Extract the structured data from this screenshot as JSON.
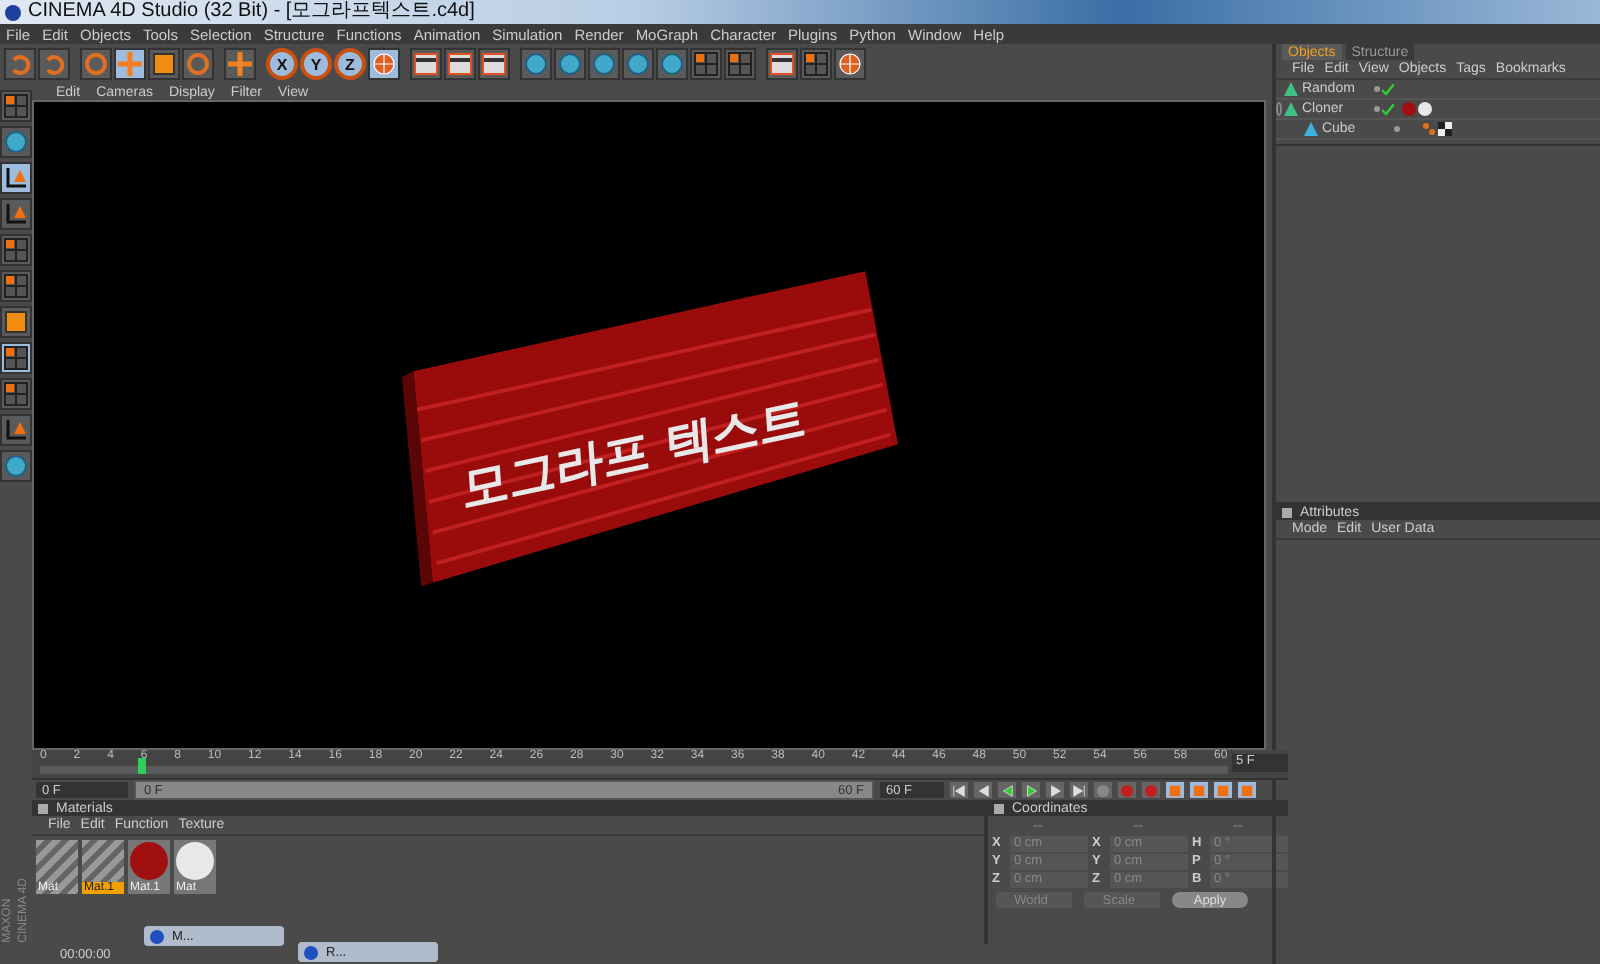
{
  "window": {
    "title": "CINEMA 4D Studio (32 Bit) - [모그라프텍스트.c4d]"
  },
  "menu": [
    "File",
    "Edit",
    "Objects",
    "Tools",
    "Selection",
    "Structure",
    "Functions",
    "Animation",
    "Simulation",
    "Render",
    "MoGraph",
    "Character",
    "Plugins",
    "Python",
    "Window",
    "Help"
  ],
  "toolbar": [
    {
      "kind": "arrow",
      "selected": false
    },
    {
      "kind": "arrow",
      "selected": false
    },
    {
      "kind": "ring",
      "selected": false
    },
    {
      "kind": "cross",
      "selected": true
    },
    {
      "kind": "square",
      "selected": false
    },
    {
      "kind": "ring",
      "selected": false
    },
    {
      "kind": "cross",
      "selected": false
    },
    {
      "kind": "letter",
      "label": "X",
      "selected": true
    },
    {
      "kind": "letter",
      "label": "Y",
      "selected": true
    },
    {
      "kind": "letter",
      "label": "Z",
      "selected": true
    },
    {
      "kind": "globe",
      "selected": true
    },
    {
      "kind": "film",
      "selected": false
    },
    {
      "kind": "film",
      "selected": false
    },
    {
      "kind": "film",
      "selected": false
    },
    {
      "kind": "sphere",
      "selected": false
    },
    {
      "kind": "sphere",
      "selected": false
    },
    {
      "kind": "sphere",
      "selected": false
    },
    {
      "kind": "sphere",
      "selected": false
    },
    {
      "kind": "sphere",
      "selected": false
    },
    {
      "kind": "grid",
      "selected": false
    },
    {
      "kind": "grid",
      "selected": false
    },
    {
      "kind": "film",
      "selected": false
    },
    {
      "kind": "grid",
      "selected": false
    },
    {
      "kind": "globe",
      "selected": false
    }
  ],
  "left_toolbar": [
    {
      "kind": "grid",
      "selected": false
    },
    {
      "kind": "sphere",
      "selected": false
    },
    {
      "kind": "axis",
      "selected": true
    },
    {
      "kind": "axis",
      "selected": false
    },
    {
      "kind": "grid",
      "selected": false
    },
    {
      "kind": "grid",
      "selected": false
    },
    {
      "kind": "square",
      "selected": false
    },
    {
      "kind": "grid",
      "selected": true
    },
    {
      "kind": "grid",
      "selected": false
    },
    {
      "kind": "axis",
      "selected": false
    },
    {
      "kind": "sphere",
      "selected": false
    }
  ],
  "viewport": {
    "menu": [
      "Edit",
      "Cameras",
      "Display",
      "Filter",
      "View"
    ],
    "scene_text": "모그라프 텍스트"
  },
  "objects_panel": {
    "tabs": [
      {
        "label": "Objects",
        "selected": true
      },
      {
        "label": "Structure",
        "selected": false
      }
    ],
    "menu": [
      "File",
      "Edit",
      "View",
      "Objects",
      "Tags",
      "Bookmarks"
    ],
    "tree": [
      {
        "name": "Random",
        "enabled": true
      },
      {
        "name": "Cloner",
        "enabled": true,
        "expanded": true,
        "tags": [
          {
            "kind": "ball",
            "color": "#a01010"
          },
          {
            "kind": "ball",
            "color": "#e8e8e8"
          }
        ],
        "children": [
          {
            "name": "Cube",
            "enabled": false,
            "tags": [
              {
                "kind": "dots",
                "color": "#e07020"
              },
              {
                "kind": "checker",
                "color": "#202020"
              }
            ]
          }
        ]
      }
    ]
  },
  "attributes_panel": {
    "title": "Attributes",
    "menu": [
      "Mode",
      "Edit",
      "User Data"
    ]
  },
  "timeline": {
    "ticks": [
      "0",
      "2",
      "4",
      "6",
      "8",
      "10",
      "12",
      "14",
      "16",
      "18",
      "20",
      "22",
      "24",
      "26",
      "28",
      "30",
      "32",
      "34",
      "36",
      "38",
      "40",
      "42",
      "44",
      "46",
      "48",
      "50",
      "52",
      "54",
      "56",
      "58",
      "60"
    ],
    "level": 0.083,
    "current_frame": "5 F",
    "start_field": "0 F",
    "range_bar": {
      "level": 1
    },
    "range_start": "0 F",
    "range_end": "60 F",
    "end_field": "60 F"
  },
  "materials": {
    "title": "Materials",
    "menu": [
      "File",
      "Edit",
      "Function",
      "Texture"
    ],
    "items": [
      {
        "name": "Mat",
        "kind": "striped",
        "selected": false
      },
      {
        "name": "Mat.1",
        "kind": "striped",
        "selected": true
      },
      {
        "name": "Mat.1",
        "kind": "ball",
        "color": "#a01010",
        "selected": false
      },
      {
        "name": "Mat",
        "kind": "ball",
        "color": "#e8e8e8",
        "selected": false
      }
    ]
  },
  "coordinates": {
    "title": "Coordinates",
    "headers": [
      "--",
      "--",
      "--"
    ],
    "rows": [
      [
        "X",
        "0 cm",
        "X",
        "0 cm",
        "H",
        "0 °"
      ],
      [
        "Y",
        "0 cm",
        "Y",
        "0 cm",
        "P",
        "0 °"
      ],
      [
        "Z",
        "0 cm",
        "Z",
        "0 cm",
        "B",
        "0 °"
      ]
    ],
    "dropdowns": [
      "World",
      "Scale"
    ],
    "apply": "Apply"
  },
  "logo": [
    "MAXON",
    "CINEMA 4D"
  ],
  "minimized_windows": [
    "M...",
    "R..."
  ],
  "status": "00:00:00"
}
